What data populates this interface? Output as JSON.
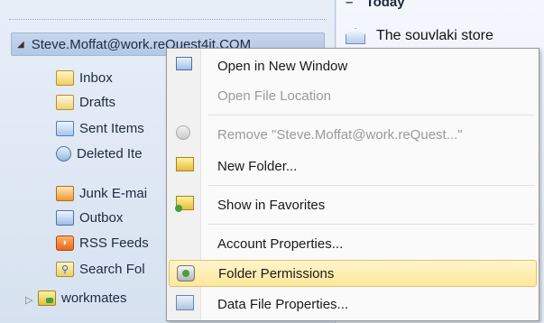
{
  "navigation": {
    "account": "Steve.Moffat@work.reQuest4it.COM",
    "folders": [
      {
        "label": "Inbox",
        "icon": "inbox-icon"
      },
      {
        "label": "Drafts",
        "icon": "drafts-icon"
      },
      {
        "label": "Sent Items",
        "icon": "sent-items-icon"
      },
      {
        "label": "Deleted Ite",
        "icon": "deleted-items-icon"
      },
      {
        "label": "Junk E-mai",
        "icon": "junk-email-icon"
      },
      {
        "label": "Outbox",
        "icon": "outbox-icon"
      },
      {
        "label": "RSS Feeds",
        "icon": "rss-feeds-icon"
      },
      {
        "label": "Search Fol",
        "icon": "search-folders-icon"
      },
      {
        "label": "workmates",
        "icon": "shared-folder-icon"
      }
    ]
  },
  "message_list": {
    "group_header": "Today",
    "message_subject": "The souvlaki store"
  },
  "context_menu": {
    "items": [
      {
        "label": "Open in New Window",
        "enabled": true,
        "highlighted": false,
        "icon": "new-window-icon"
      },
      {
        "label": "Open File Location",
        "enabled": false,
        "highlighted": false,
        "icon": ""
      },
      {
        "label": "Remove \"Steve.Moffat@work.reQuest...\"",
        "enabled": false,
        "highlighted": false,
        "icon": "remove-account-icon"
      },
      {
        "label": "New Folder...",
        "enabled": true,
        "highlighted": false,
        "icon": "new-folder-icon"
      },
      {
        "label": "Show in Favorites",
        "enabled": true,
        "highlighted": false,
        "icon": "favorites-icon"
      },
      {
        "label": "Account Properties...",
        "enabled": true,
        "highlighted": false,
        "icon": ""
      },
      {
        "label": "Folder Permissions",
        "enabled": true,
        "highlighted": true,
        "icon": "folder-permissions-icon"
      },
      {
        "label": "Data File Properties...",
        "enabled": true,
        "highlighted": false,
        "icon": "data-file-properties-icon"
      }
    ]
  },
  "colors": {
    "highlight": "#fde89b",
    "disabled_text": "#9a9a9a",
    "nav_background": "#dde6f2"
  }
}
